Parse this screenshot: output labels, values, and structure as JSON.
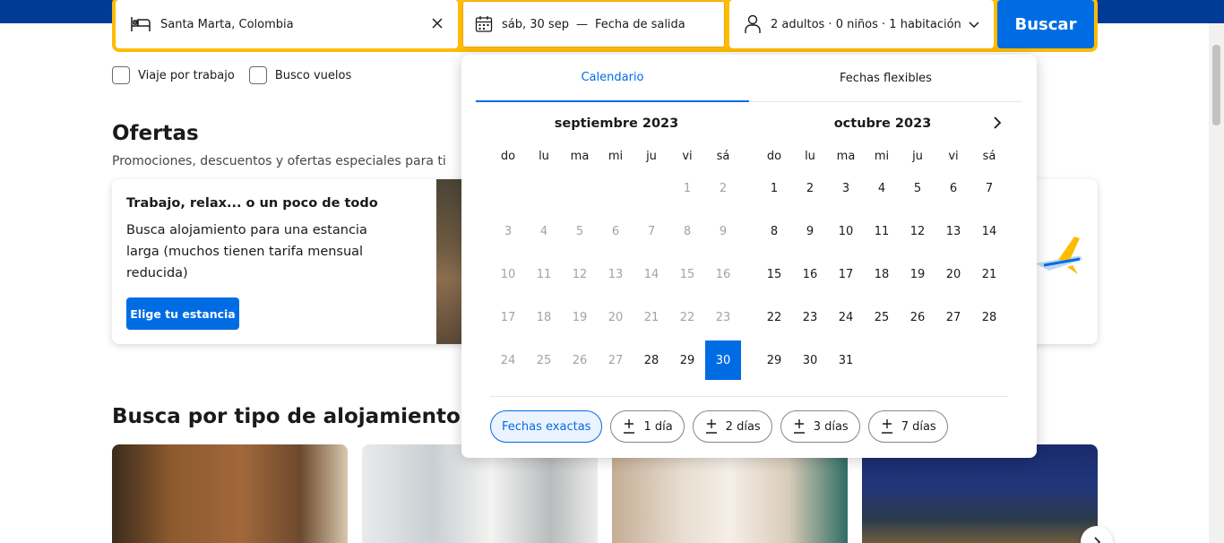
{
  "search": {
    "destination": "Santa Marta, Colombia",
    "checkin": "sáb, 30 sep",
    "dash": "—",
    "checkout_placeholder": "Fecha de salida",
    "occupancy": "2 adultos · 0 niños · 1 habitación",
    "search_label": "Buscar"
  },
  "options": {
    "business": "Viaje por trabajo",
    "flights": "Busco vuelos"
  },
  "offers": {
    "title": "Ofertas",
    "subtitle": "Promociones, descuentos y ofertas especiales para ti",
    "card_title": "Trabajo, relax... o un poco de todo",
    "card_desc": "Busca alojamiento para una estancia larga (muchos tienen tarifa mensual reducida)",
    "card_button": "Elige tu estancia"
  },
  "types": {
    "title": "Busca por tipo de alojamiento"
  },
  "calendar": {
    "tabs": [
      "Calendario",
      "Fechas flexibles"
    ],
    "active_tab": 0,
    "weekdays": [
      "do",
      "lu",
      "ma",
      "mi",
      "ju",
      "vi",
      "sá"
    ],
    "months": [
      {
        "title": "septiembre 2023",
        "weeks": [
          [
            "",
            "",
            "",
            "",
            "",
            "1",
            "2"
          ],
          [
            "3",
            "4",
            "5",
            "6",
            "7",
            "8",
            "9"
          ],
          [
            "10",
            "11",
            "12",
            "13",
            "14",
            "15",
            "16"
          ],
          [
            "17",
            "18",
            "19",
            "20",
            "21",
            "22",
            "23"
          ],
          [
            "24",
            "25",
            "26",
            "27",
            "28",
            "29",
            "30"
          ]
        ],
        "past_through": 27,
        "selected": 30
      },
      {
        "title": "octubre 2023",
        "weeks": [
          [
            "1",
            "2",
            "3",
            "4",
            "5",
            "6",
            "7"
          ],
          [
            "8",
            "9",
            "10",
            "11",
            "12",
            "13",
            "14"
          ],
          [
            "15",
            "16",
            "17",
            "18",
            "19",
            "20",
            "21"
          ],
          [
            "22",
            "23",
            "24",
            "25",
            "26",
            "27",
            "28"
          ],
          [
            "29",
            "30",
            "31",
            "",
            "",
            "",
            ""
          ]
        ],
        "past_through": 0,
        "selected": null
      }
    ],
    "chips": [
      "Fechas exactas",
      "1 día",
      "2 días",
      "3 días",
      "7 días"
    ],
    "active_chip": 0
  },
  "colors": {
    "brand_blue": "#003b95",
    "accent": "#006ce4",
    "highlight": "#febb02"
  },
  "icons": [
    "bed-icon",
    "close-icon",
    "calendar-icon",
    "person-icon",
    "chevron-down-icon",
    "chevron-right-icon",
    "plus-minus-icon",
    "airplane-icon"
  ]
}
